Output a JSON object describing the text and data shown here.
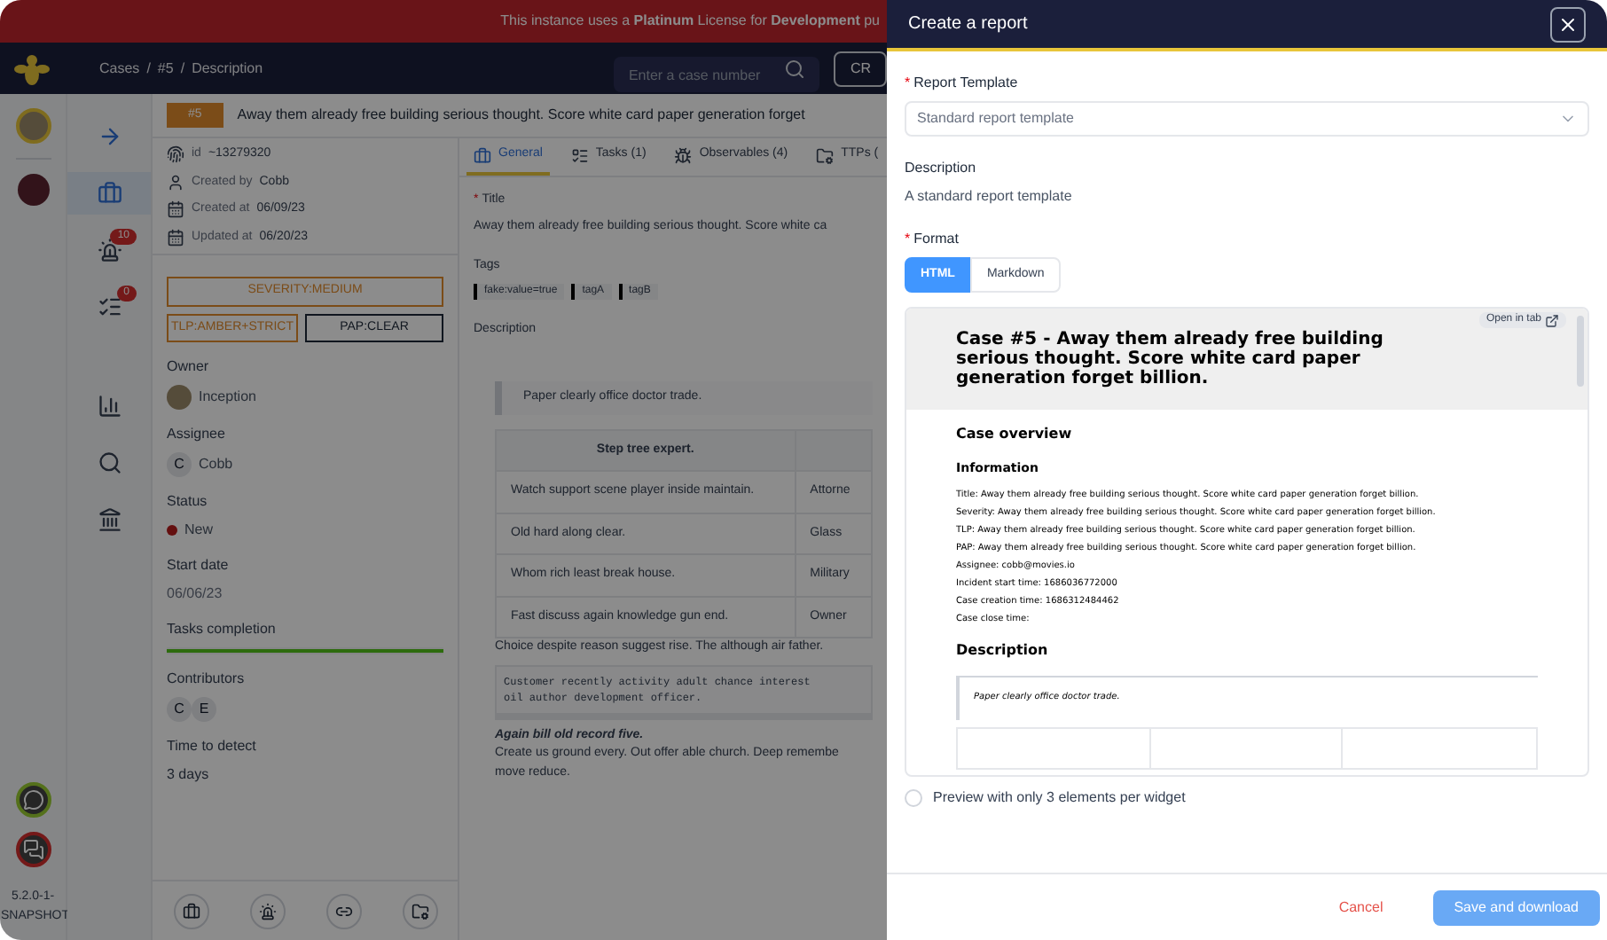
{
  "banner": {
    "text": "This instance uses a **Platinum** License for **Development** pu"
  },
  "header": {
    "breadcrumb": [
      "Cases",
      "#5",
      "Description"
    ],
    "separator": "/",
    "search": {
      "placeholder": "Enter a case number"
    },
    "button": "CR"
  },
  "rail": {
    "version": "5.2.0-1-SNAPSHOT"
  },
  "nav": [
    {
      "kind": "arrow",
      "selected": false
    },
    {
      "kind": "cases",
      "selected": true
    },
    {
      "kind": "alerts",
      "selected": false,
      "badge": "10"
    },
    {
      "kind": "tasks",
      "selected": false,
      "badge": "0"
    },
    {
      "kind": "dashboards",
      "selected": false
    },
    {
      "kind": "search",
      "selected": false
    },
    {
      "kind": "organisation",
      "selected": false
    }
  ],
  "case": {
    "number": "#5",
    "title": "Away them already free building serious thought. Score white card paper generation forget"
  },
  "details": {
    "meta": [
      {
        "kind": "id",
        "label": "id",
        "value": "~13279320"
      },
      {
        "kind": "user",
        "label": "Created by",
        "value": "Cobb"
      },
      {
        "kind": "calendar",
        "label": "Created at",
        "value": "06/09/23"
      },
      {
        "kind": "calendar",
        "label": "Updated at",
        "value": "06/20/23"
      }
    ],
    "severity": "SEVERITY:MEDIUM",
    "tlp": "TLP:AMBER+STRICT",
    "pap": "PAP:CLEAR",
    "owner": {
      "label": "Owner",
      "name": "Inception"
    },
    "assignee": {
      "label": "Assignee",
      "initial": "C",
      "name": "Cobb"
    },
    "status": {
      "label": "Status",
      "value": "New"
    },
    "start_date": {
      "label": "Start date",
      "value": "06/06/23"
    },
    "tasks_completion": {
      "label": "Tasks completion",
      "level": 1
    },
    "contributors": {
      "label": "Contributors",
      "initials": [
        "C",
        "E"
      ]
    },
    "time_to_detect": {
      "label": "Time to detect",
      "value": "3 days"
    }
  },
  "tabs": [
    {
      "kind": "general",
      "label": "General",
      "selected": true
    },
    {
      "kind": "tasks",
      "label": "Tasks (1)",
      "selected": false
    },
    {
      "kind": "observables",
      "label": "Observables (4)",
      "selected": false
    },
    {
      "kind": "ttps",
      "label": "TTPs (",
      "selected": false
    }
  ],
  "general": {
    "title_mark": "*",
    "title_label": "Title",
    "title": "Away them already free building serious thought. Score white ca",
    "tags_label": "Tags",
    "tags": [
      "fake:value=true",
      "tagA",
      "tagB"
    ],
    "description_label": "Description",
    "quote": "Paper clearly office doctor trade.",
    "table": {
      "header": "Step tree expert.",
      "rows": [
        [
          "Watch support scene player inside maintain.",
          "Attorne"
        ],
        [
          "Old hard along clear.",
          "Glass"
        ],
        [
          "Whom rich least break house.",
          "Military"
        ],
        [
          "Fast discuss again knowledge gun end.",
          "Owner"
        ]
      ]
    },
    "caption": "Choice despite reason suggest rise. The although air father.",
    "code": [
      "Customer recently activity adult chance interest",
      "oil author development officer."
    ],
    "subheading": "Again bill old record five.",
    "paragraph": [
      "Create us ground every. Out offer able church. Deep remembe",
      "move reduce."
    ]
  },
  "drawer": {
    "title": "Create a report",
    "template": {
      "mark": "*",
      "label": "Report Template",
      "value": "Standard report template"
    },
    "description": {
      "label": "Description",
      "text": "A standard report template"
    },
    "format": {
      "mark": "*",
      "label": "Format",
      "options": [
        {
          "label": "HTML",
          "selected": true
        },
        {
          "label": "Markdown",
          "selected": false
        }
      ]
    },
    "preview": {
      "open_in_tab": "Open in tab",
      "heading": "Case #5 - Away them already free building serious thought. Score white card paper generation forget billion.",
      "overview": "Case overview",
      "information": "Information",
      "lines": [
        "Title: Away them already free building serious thought. Score white card paper generation forget billion.",
        "Severity: Away them already free building serious thought. Score white card paper generation forget billion.",
        "TLP: Away them already free building serious thought. Score white card paper generation forget billion.",
        "PAP: Away them already free building serious thought. Score white card paper generation forget billion.",
        "Assignee: cobb@movies.io",
        "Incident start time: 1686036772000",
        "Case creation time: 1686312484462",
        "Case close time:"
      ],
      "description": "Description",
      "quote": "Paper clearly office doctor trade."
    },
    "checkbox": {
      "label": "Preview with only 3 elements per widget",
      "checked": false
    },
    "cancel": "Cancel",
    "save": "Save and download"
  }
}
